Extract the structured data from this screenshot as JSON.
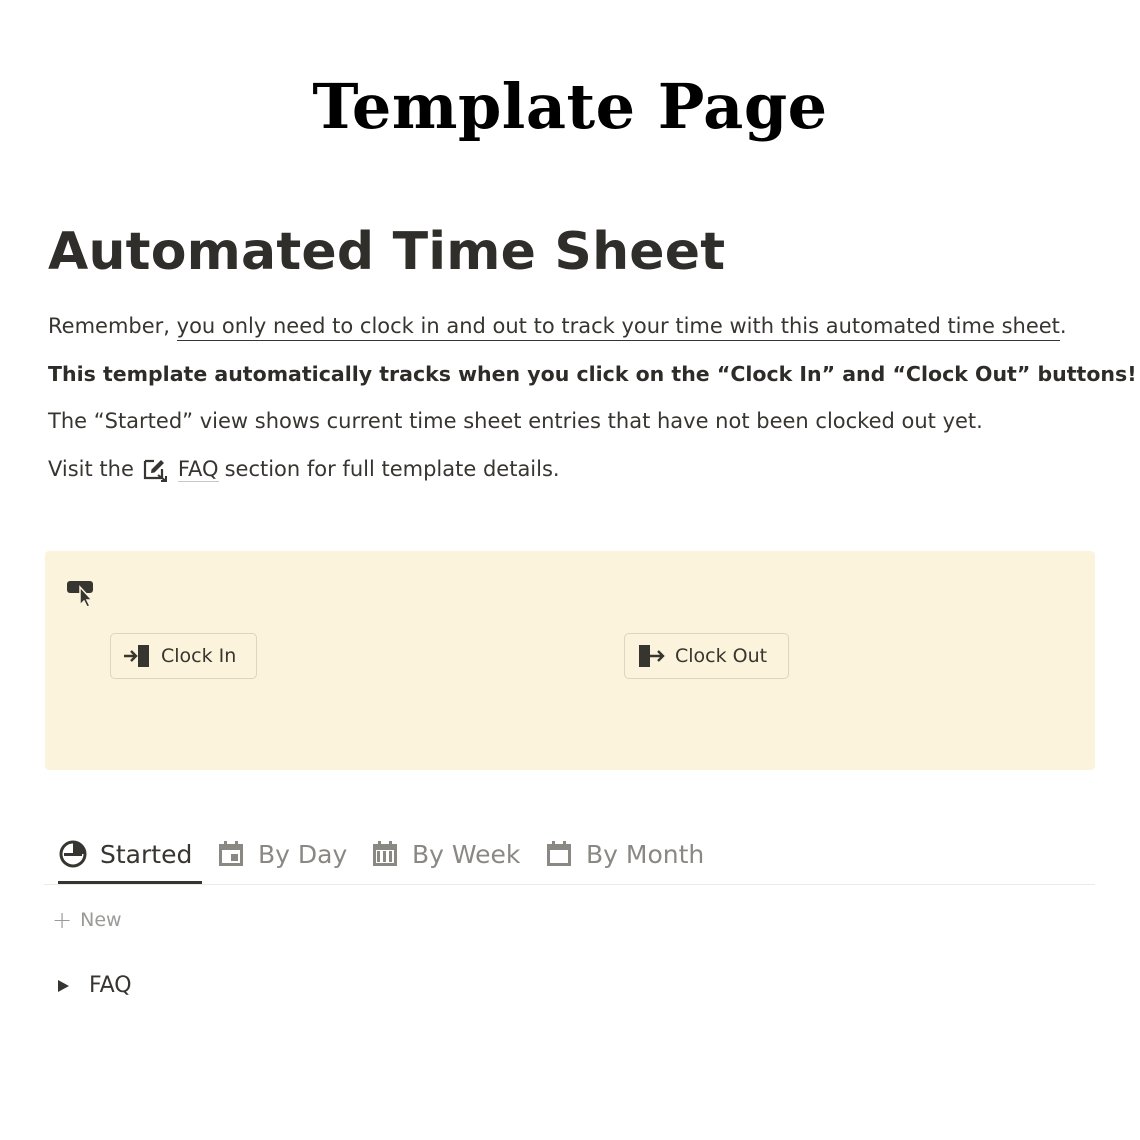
{
  "banner": {
    "text": "Template Page"
  },
  "page": {
    "title": "Automated Time Sheet",
    "paragraphs": {
      "p1_prefix": "Remember, ",
      "p1_link": "you only need to clock in and out to track your time with this automated time sheet",
      "p1_suffix": ".",
      "p2": "This template automatically tracks when you click on the “Clock In” and “Clock Out” buttons!",
      "p3": "The “Started” view shows current time sheet entries that have not been clocked out yet.",
      "p4_prefix": "Visit the",
      "p4_link": "FAQ",
      "p4_suffix": "section for full template details."
    }
  },
  "callout": {
    "icon": "pointer-click-icon",
    "clock_in_label": "Clock In",
    "clock_out_label": "Clock Out",
    "background": "#fbf3dc"
  },
  "views": {
    "tabs": [
      {
        "label": "Started",
        "icon": "timer-icon",
        "active": true
      },
      {
        "label": "By Day",
        "icon": "calendar-day-icon",
        "active": false
      },
      {
        "label": "By Week",
        "icon": "calendar-week-icon",
        "active": false
      },
      {
        "label": "By Month",
        "icon": "calendar-month-icon",
        "active": false
      }
    ],
    "new_label": "New"
  },
  "toggle": {
    "label": "FAQ"
  }
}
